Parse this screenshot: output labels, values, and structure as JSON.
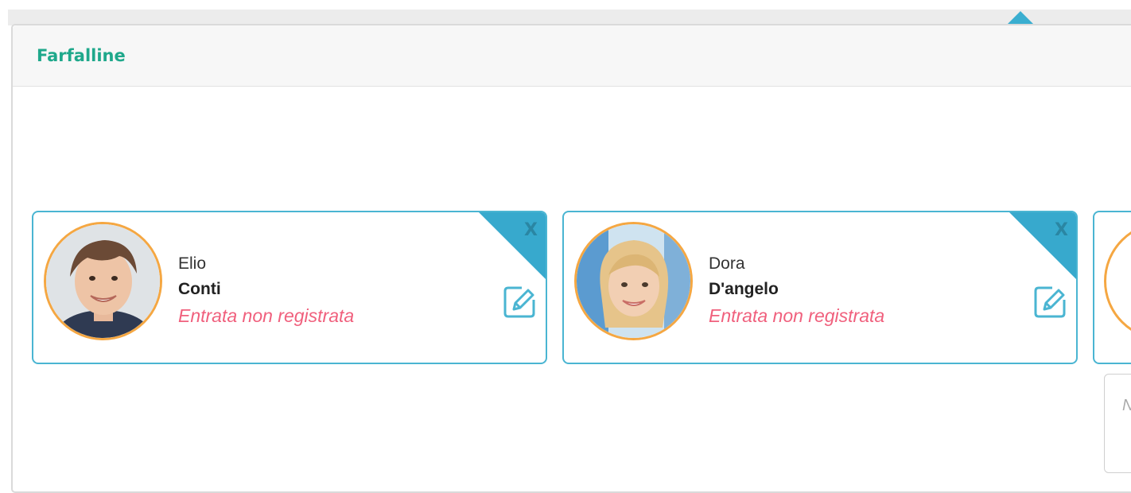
{
  "group": {
    "title": "Farfalline"
  },
  "children": [
    {
      "first_name": "Elio",
      "last_name": "Conti",
      "status": "Entrata non registrata",
      "remove_label": "X",
      "avatar": "child-photo-boy"
    },
    {
      "first_name": "Dora",
      "last_name": "D'angelo",
      "status": "Entrata non registrata",
      "remove_label": "X",
      "avatar": "child-photo-girl"
    }
  ],
  "partial": {
    "note_placeholder_fragment": "N"
  },
  "colors": {
    "accent": "#37a9cd",
    "title": "#1fa88b",
    "status": "#f0607d",
    "avatar_ring": "#f5a742"
  },
  "icons": {
    "edit": "pencil-square-icon",
    "remove": "close-icon"
  }
}
